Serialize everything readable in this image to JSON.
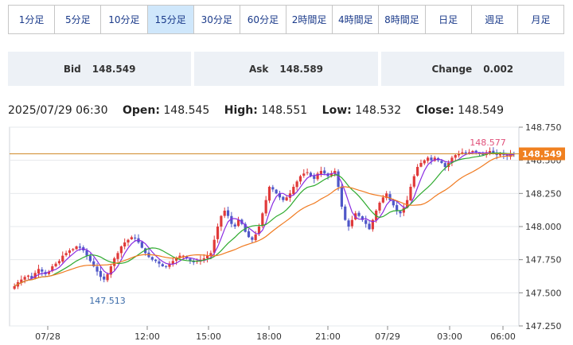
{
  "timeframes": [
    {
      "label": "1分足",
      "active": false
    },
    {
      "label": "5分足",
      "active": false
    },
    {
      "label": "10分足",
      "active": false
    },
    {
      "label": "15分足",
      "active": true
    },
    {
      "label": "30分足",
      "active": false
    },
    {
      "label": "60分足",
      "active": false
    },
    {
      "label": "2時間足",
      "active": false
    },
    {
      "label": "4時間足",
      "active": false
    },
    {
      "label": "8時間足",
      "active": false
    },
    {
      "label": "日足",
      "active": false
    },
    {
      "label": "週足",
      "active": false
    },
    {
      "label": "月足",
      "active": false
    }
  ],
  "quotes": {
    "bid_label": "Bid",
    "bid_value": "148.549",
    "ask_label": "Ask",
    "ask_value": "148.589",
    "change_label": "Change",
    "change_value": "0.002"
  },
  "ohlc": {
    "datetime": "2025/07/29 06:30",
    "open_label": "Open:",
    "open": "148.545",
    "high_label": "High:",
    "high": "148.551",
    "low_label": "Low:",
    "low": "148.532",
    "close_label": "Close:",
    "close": "148.549"
  },
  "chart_data": {
    "type": "candlestick",
    "y_ticks": [
      "148.750",
      "148.500",
      "148.250",
      "148.000",
      "147.750",
      "147.500",
      "147.250"
    ],
    "y_tick_values": [
      148.75,
      148.5,
      148.25,
      148.0,
      147.75,
      147.5,
      147.25
    ],
    "ylim": [
      147.25,
      148.75
    ],
    "x_tick_labels": [
      "07/28",
      "12:00",
      "15:00",
      "18:00",
      "21:00",
      "07/29",
      "03:00",
      "06:00"
    ],
    "current_price_label": "148.549",
    "current_price": 148.549,
    "high_annotation": "148.577",
    "high_value": 148.577,
    "low_annotation": "147.513",
    "low_value": 147.513,
    "colors": {
      "up": "#e03a3a",
      "down": "#4f57c8",
      "ma_short": "#8a2be2",
      "ma_mid": "#2eaa2e",
      "ma_long": "#f07a20",
      "price_line": "#d08a2a",
      "price_tag": "#f08020"
    },
    "series_close": [
      147.55,
      147.58,
      147.6,
      147.62,
      147.63,
      147.61,
      147.65,
      147.68,
      147.66,
      147.64,
      147.66,
      147.7,
      147.72,
      147.74,
      147.78,
      147.8,
      147.82,
      147.83,
      147.85,
      147.84,
      147.82,
      147.78,
      147.74,
      147.7,
      147.66,
      147.62,
      147.6,
      147.64,
      147.7,
      147.76,
      147.8,
      147.85,
      147.88,
      147.9,
      147.92,
      147.91,
      147.88,
      147.84,
      147.8,
      147.77,
      147.75,
      147.74,
      147.72,
      147.7,
      147.7,
      147.72,
      147.74,
      147.76,
      147.78,
      147.78,
      147.76,
      147.74,
      147.73,
      147.74,
      147.75,
      147.76,
      147.78,
      147.8,
      147.9,
      148.0,
      148.08,
      148.12,
      148.08,
      148.02,
      148.0,
      148.05,
      148.02,
      147.96,
      147.92,
      147.9,
      147.94,
      148.0,
      148.1,
      148.2,
      148.3,
      148.28,
      148.25,
      148.22,
      148.2,
      148.22,
      148.25,
      148.3,
      148.34,
      148.38,
      148.4,
      148.41,
      148.38,
      148.36,
      148.4,
      148.42,
      148.4,
      148.38,
      148.4,
      148.42,
      148.3,
      148.15,
      148.05,
      148.0,
      148.05,
      148.1,
      148.08,
      148.05,
      148.02,
      147.98,
      148.05,
      148.12,
      148.18,
      148.22,
      148.25,
      148.2,
      148.16,
      148.12,
      148.1,
      148.14,
      148.2,
      148.3,
      148.38,
      148.45,
      148.48,
      148.5,
      148.52,
      148.5,
      148.52,
      148.5,
      148.48,
      148.45,
      148.48,
      148.52,
      148.54,
      148.55,
      148.56,
      148.55,
      148.56,
      148.57,
      148.56,
      148.55,
      148.54,
      148.56,
      148.57,
      148.55,
      148.54,
      148.55,
      148.54,
      148.53,
      148.55,
      148.549
    ]
  }
}
